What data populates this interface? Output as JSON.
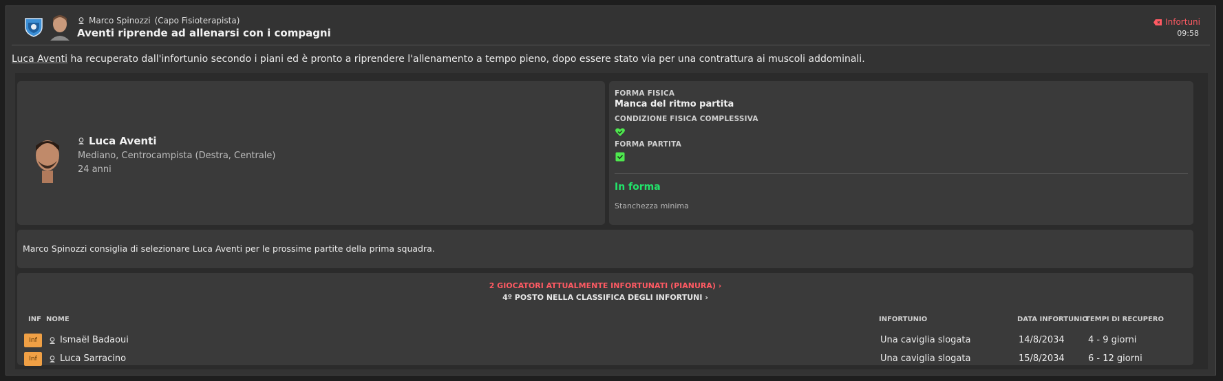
{
  "header": {
    "sender_name": "Marco Spinozzi",
    "sender_role": "(Capo Fisioterapista)",
    "title": "Aventi riprende ad allenarsi con i compagni",
    "category": "Infortuni",
    "time": "09:58"
  },
  "message": {
    "player_link": "Luca Aventi",
    "body": " ha recuperato dall'infortunio secondo i piani ed è pronto a riprendere l'allenamento a tempo pieno, dopo essere stato via per una contrattura ai muscoli addominali."
  },
  "player": {
    "name": "Luca Aventi",
    "role": "Mediano, Centrocampista (Destra, Centrale)",
    "age": "24 anni"
  },
  "fitness": {
    "forma_fisica_label": "FORMA FISICA",
    "forma_fisica_value": "Manca del ritmo partita",
    "condizione_label": "CONDIZIONE FISICA COMPLESSIVA",
    "forma_partita_label": "FORMA PARTITA",
    "status": "In forma",
    "fatigue": "Stanchezza minima",
    "colors": {
      "good": "#22e36a",
      "icon": "#4ee84e"
    }
  },
  "advice": "Marco Spinozzi consiglia di selezionare Luca Aventi per le prossime partite della prima squadra.",
  "injuries": {
    "link_injured": "2 GIOCATORI ATTUALMENTE INFORTUNATI (PIANURA)",
    "link_table": "4º POSTO NELLA CLASSIFICA DEGLI INFORTUNI",
    "columns": {
      "inf": "INF",
      "nome": "NOME",
      "infortunio": "INFORTUNIO",
      "data": "DATA INFORTUNIO",
      "tempi": "TEMPI DI RECUPERO"
    },
    "rows": [
      {
        "badge": "Inf",
        "name": "Ismaël Badaoui",
        "injury": "Una caviglia slogata",
        "date": "14/8/2034",
        "recovery": "4 - 9 giorni"
      },
      {
        "badge": "Inf",
        "name": "Luca Sarracino",
        "injury": "Una caviglia slogata",
        "date": "15/8/2034",
        "recovery": "6 - 12 giorni"
      }
    ]
  },
  "colors": {
    "accent_red": "#ff5a63",
    "badge_orange": "#f0a045",
    "panel": "#3a3a3a"
  },
  "icons": [
    "club-badge-icon",
    "person-icon",
    "injury-tag-icon",
    "heart-icon",
    "check-icon",
    "chevron-right-icon"
  ]
}
